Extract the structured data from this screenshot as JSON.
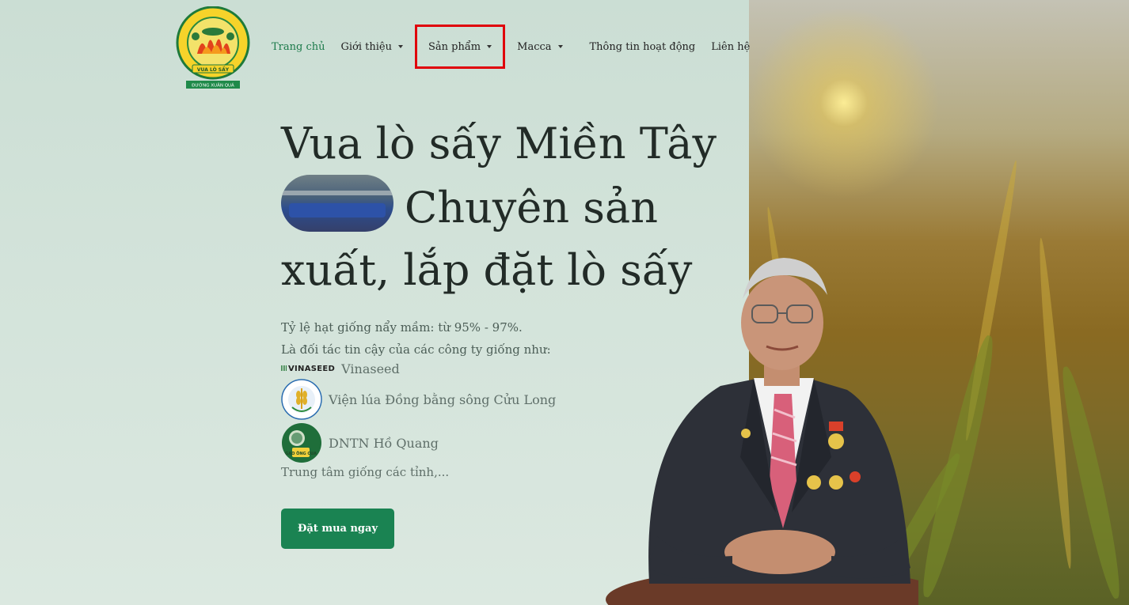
{
  "nav": {
    "items": [
      {
        "label": "Trang chủ",
        "active": true,
        "dropdown": false
      },
      {
        "label": "Giới thiệu",
        "dropdown": true
      },
      {
        "label": "Sản phẩm",
        "dropdown": true,
        "highlighted": true
      },
      {
        "label": "Macca",
        "dropdown": true
      },
      {
        "label": "Thông tin hoạt động",
        "dropdown": false
      },
      {
        "label": "Liên hệ",
        "dropdown": false
      }
    ]
  },
  "logo": {
    "arc_text": "Công nghệ rất hay",
    "banner": "VUA LÒ SẤY",
    "footer": "ĐƯỜNG XUÂN QUÁ"
  },
  "hero": {
    "line1": "Vua lò sấy Miền Tây",
    "line2": "Chuyên sản",
    "line3": "xuất, lắp đặt lò sấy"
  },
  "description": {
    "germination": "Tỷ lệ hạt giống nẩy mầm: từ 95% - 97%.",
    "partners_intro": "Là đối tác tin cậy của các công ty giống như:"
  },
  "partners": [
    {
      "logo_text": "VINASEED",
      "name": "Vinaseed"
    },
    {
      "name": "Viện lúa Đồng bằng sông Cửu Long"
    },
    {
      "logo_text": "GẠO ÔNG CUA",
      "name": "DNTN Hồ Quang"
    }
  ],
  "trung_tam": "Trung tâm giống các tỉnh,...",
  "cta": {
    "label": "Đặt mua ngay",
    "color": "#1a8352"
  },
  "colors": {
    "accent": "#1b7a4a",
    "highlight_box": "#e0000a"
  }
}
